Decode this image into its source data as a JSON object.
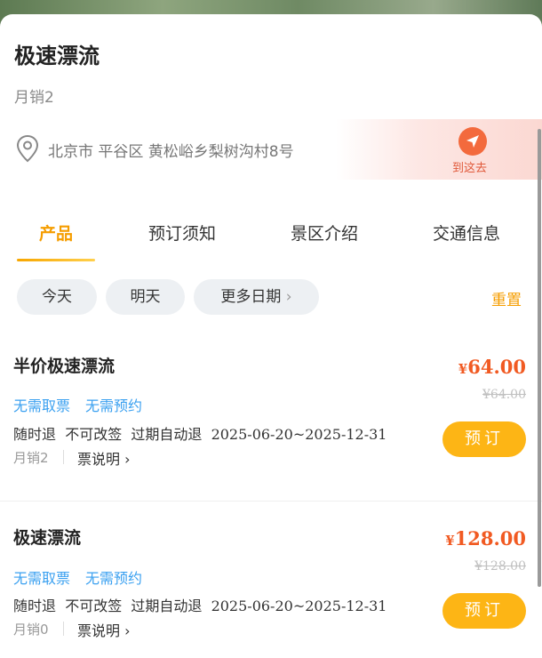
{
  "product": {
    "title": "极速漂流",
    "monthly_sales": "月销2",
    "address": "北京市 平谷区 黄松峪乡梨树沟村8号",
    "navigate_label": "到这去"
  },
  "tabs": [
    {
      "label": "产品",
      "active": true
    },
    {
      "label": "预订须知",
      "active": false
    },
    {
      "label": "景区介绍",
      "active": false
    },
    {
      "label": "交通信息",
      "active": false
    }
  ],
  "date_filter": {
    "today": "今天",
    "tomorrow": "明天",
    "more_dates": "更多日期",
    "more_chevron": "›",
    "reset": "重置"
  },
  "tickets": [
    {
      "name": "半价极速漂流",
      "tags": [
        "无需取票",
        "无需预约"
      ],
      "rules": [
        "随时退",
        "不可改签",
        "过期自动退"
      ],
      "date_range": "2025-06-20~2025-12-31",
      "sold": "月销2",
      "ticket_note": "票说明 ›",
      "currency": "¥",
      "price": "64.00",
      "original_price": "¥64.00",
      "book_label": "预订"
    },
    {
      "name": "极速漂流",
      "tags": [
        "无需取票",
        "无需预约"
      ],
      "rules": [
        "随时退",
        "不可改签",
        "过期自动退"
      ],
      "date_range": "2025-06-20~2025-12-31",
      "sold": "月销0",
      "ticket_note": "票说明 ›",
      "currency": "¥",
      "price": "128.00",
      "original_price": "¥128.00",
      "book_label": "预订"
    }
  ],
  "colors": {
    "accent_orange": "#f59d00",
    "price_red": "#f15a22",
    "tag_blue": "#3aa0f0",
    "button_yellow": "#fdb515"
  },
  "icons": {
    "location": "location-pin-icon",
    "navigate": "navigation-arrow-icon"
  }
}
